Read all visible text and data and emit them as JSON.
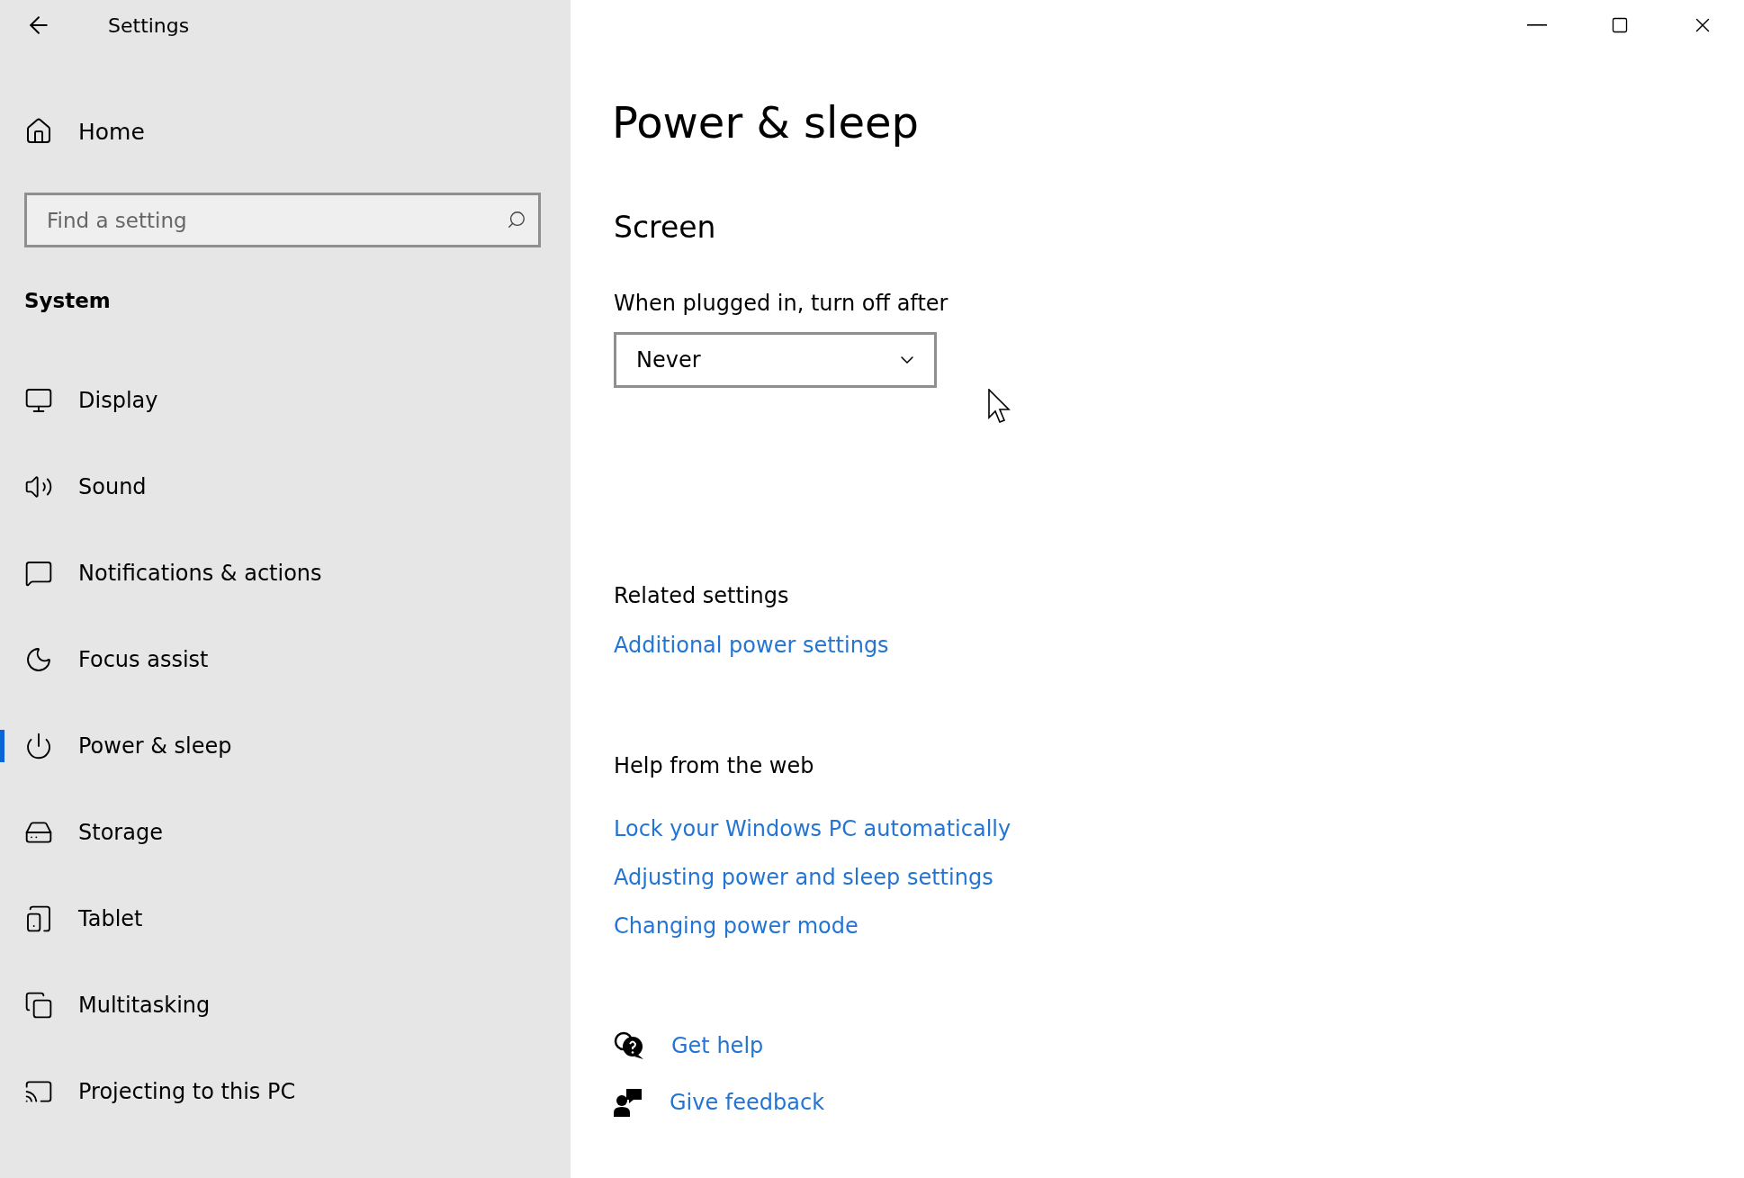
{
  "window": {
    "title": "Settings"
  },
  "sidebar": {
    "home": "Home",
    "search": {
      "placeholder": "Find a setting"
    },
    "section": "System",
    "items": [
      {
        "label": "Display",
        "selected": false
      },
      {
        "label": "Sound",
        "selected": false
      },
      {
        "label": "Notifications & actions",
        "selected": false
      },
      {
        "label": "Focus assist",
        "selected": false
      },
      {
        "label": "Power & sleep",
        "selected": true
      },
      {
        "label": "Storage",
        "selected": false
      },
      {
        "label": "Tablet",
        "selected": false
      },
      {
        "label": "Multitasking",
        "selected": false
      },
      {
        "label": "Projecting to this PC",
        "selected": false
      }
    ]
  },
  "page": {
    "title": "Power & sleep",
    "screen": {
      "heading": "Screen",
      "label": "When plugged in, turn off after",
      "dropdown": "Never"
    },
    "related": {
      "heading": "Related settings",
      "links": [
        "Additional power settings"
      ]
    },
    "help": {
      "heading": "Help from the web",
      "links": [
        "Lock your Windows PC automatically",
        "Adjusting power and sleep settings",
        "Changing power mode"
      ]
    },
    "support": [
      {
        "label": "Get help"
      },
      {
        "label": "Give feedback"
      }
    ]
  }
}
